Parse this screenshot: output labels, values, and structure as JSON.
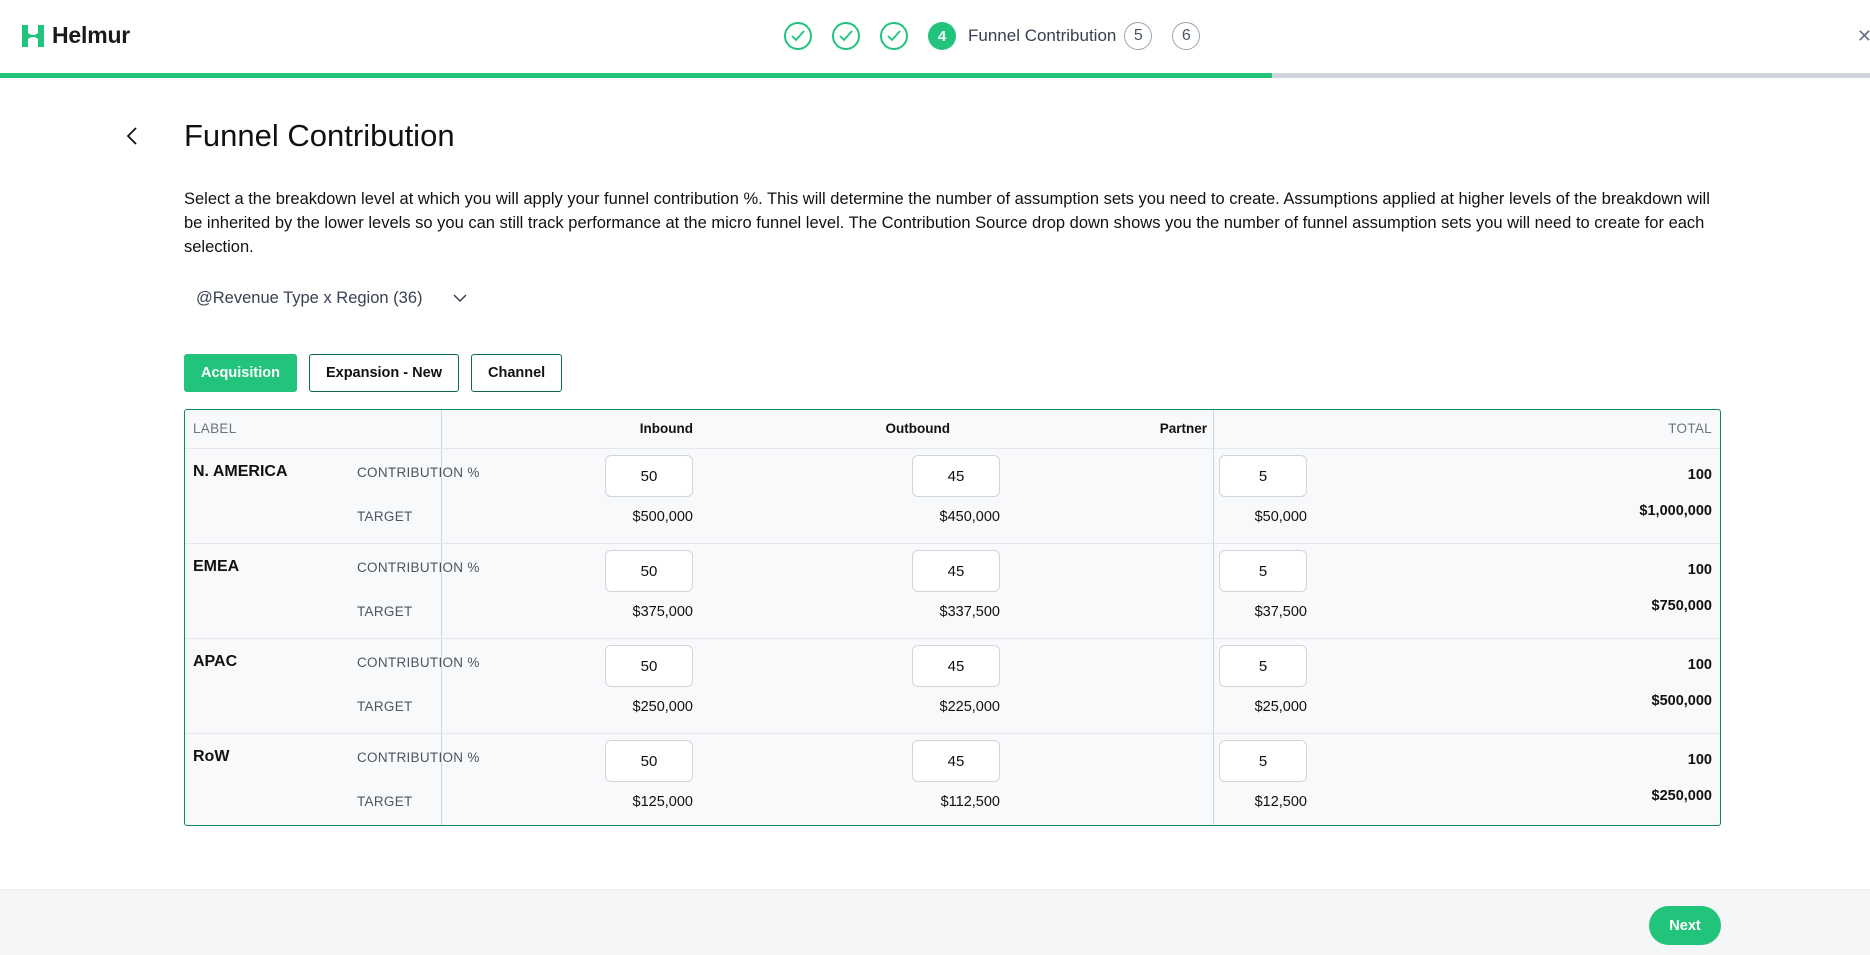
{
  "app": {
    "name": "Helmur"
  },
  "stepper": {
    "completed_count": 3,
    "active_number": "4",
    "active_label": "Funnel Contribution",
    "upcoming": [
      "5",
      "6"
    ],
    "progress_fraction": 0.68
  },
  "page": {
    "title": "Funnel Contribution",
    "description": "Select a the breakdown level at which you will apply your funnel contribution %. This will determine the number of assumption sets you need to create. Assumptions applied at higher levels of the breakdown will be inherited by the lower levels so you can still track performance at the micro funnel level. The Contribution Source drop down shows you the number of funnel assumption sets you will need to create for each selection."
  },
  "dropdown": {
    "value": "@Revenue Type x Region (36)"
  },
  "tabs": [
    {
      "label": "Acquisition",
      "active": true
    },
    {
      "label": "Expansion - New",
      "active": false
    },
    {
      "label": "Channel",
      "active": false
    }
  ],
  "table": {
    "headers": {
      "label": "LABEL",
      "inbound": "Inbound",
      "outbound": "Outbound",
      "partner": "Partner",
      "total": "TOTAL"
    },
    "sub_labels": {
      "contribution": "CONTRIBUTION %",
      "target": "TARGET"
    },
    "rows": [
      {
        "region": "N. AMERICA",
        "inbound_pct": "50",
        "outbound_pct": "45",
        "partner_pct": "5",
        "inbound_target": "$500,000",
        "outbound_target": "$450,000",
        "partner_target": "$50,000",
        "total_pct": "100",
        "total_target": "$1,000,000"
      },
      {
        "region": "EMEA",
        "inbound_pct": "50",
        "outbound_pct": "45",
        "partner_pct": "5",
        "inbound_target": "$375,000",
        "outbound_target": "$337,500",
        "partner_target": "$37,500",
        "total_pct": "100",
        "total_target": "$750,000"
      },
      {
        "region": "APAC",
        "inbound_pct": "50",
        "outbound_pct": "45",
        "partner_pct": "5",
        "inbound_target": "$250,000",
        "outbound_target": "$225,000",
        "partner_target": "$25,000",
        "total_pct": "100",
        "total_target": "$500,000"
      },
      {
        "region": "RoW",
        "inbound_pct": "50",
        "outbound_pct": "45",
        "partner_pct": "5",
        "inbound_target": "$125,000",
        "outbound_target": "$112,500",
        "partner_target": "$12,500",
        "total_pct": "100",
        "total_target": "$250,000"
      }
    ]
  },
  "footer": {
    "next_label": "Next"
  },
  "colors": {
    "accent": "#22c37a",
    "border_dark_green": "#0f8a60",
    "track": "#d1d5db"
  }
}
